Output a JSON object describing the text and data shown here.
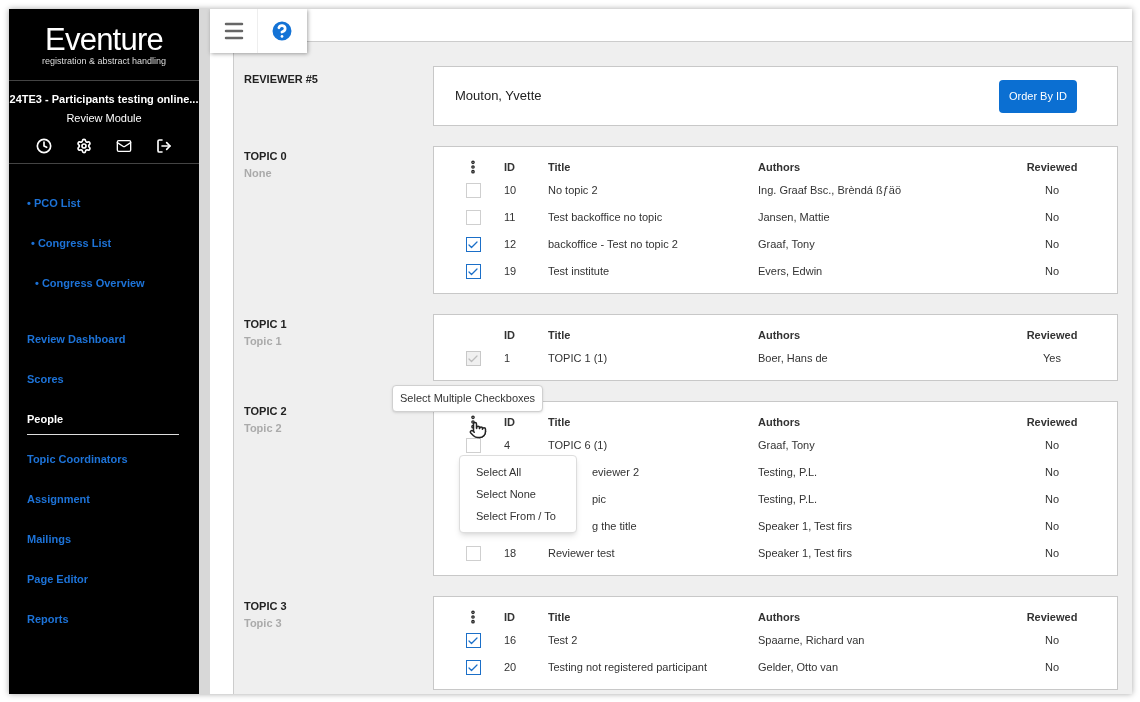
{
  "brand": {
    "logo": "Eventure",
    "tagline": "registration & abstract handling"
  },
  "event": {
    "name": "24TE3 - Participants testing online...",
    "module": "Review Module"
  },
  "nav_links": [
    {
      "label": "• PCO List"
    },
    {
      "label": "• Congress List"
    },
    {
      "label": "• Congress Overview"
    }
  ],
  "menu": [
    {
      "label": "Review Dashboard",
      "selected": false
    },
    {
      "label": "Scores",
      "selected": false
    },
    {
      "label": "People",
      "selected": true
    },
    {
      "label": "Topic Coordinators",
      "selected": false
    },
    {
      "label": "Assignment",
      "selected": false
    },
    {
      "label": "Mailings",
      "selected": false
    },
    {
      "label": "Page Editor",
      "selected": false
    },
    {
      "label": "Reports",
      "selected": false
    }
  ],
  "reviewer": {
    "label": "REVIEWER #5",
    "name": "Mouton, Yvette",
    "button": "Order By ID"
  },
  "topics": [
    {
      "label": "TOPIC 0",
      "name": "None",
      "show_menu": true,
      "columns": {
        "id": "ID",
        "title": "Title",
        "authors": "Authors",
        "reviewed": "Reviewed"
      },
      "rows": [
        {
          "kind": "full",
          "checked": false,
          "disabled": false,
          "id": "10",
          "title": "No topic 2",
          "authors": "Ing. Graaf Bsc., Brèndá ßƒäö",
          "reviewed": "No"
        },
        {
          "kind": "full",
          "checked": false,
          "disabled": false,
          "id": "11",
          "title": "Test backoffice no topic",
          "authors": "Jansen, Mattie",
          "reviewed": "No"
        },
        {
          "kind": "full",
          "checked": true,
          "disabled": false,
          "id": "12",
          "title": "backoffice - Test no topic 2",
          "authors": "Graaf, Tony",
          "reviewed": "No"
        },
        {
          "kind": "full",
          "checked": true,
          "disabled": false,
          "id": "19",
          "title": "Test institute",
          "authors": "Evers, Edwin",
          "reviewed": "No"
        }
      ]
    },
    {
      "label": "TOPIC 1",
      "name": "Topic 1",
      "show_menu": false,
      "columns": {
        "id": "ID",
        "title": "Title",
        "authors": "Authors",
        "reviewed": "Reviewed"
      },
      "rows": [
        {
          "kind": "full",
          "checked": true,
          "disabled": true,
          "id": "1",
          "title": "TOPIC 1 (1)",
          "authors": "Boer, Hans de",
          "reviewed": "Yes"
        }
      ]
    },
    {
      "label": "TOPIC 2",
      "name": "Topic 2",
      "show_menu": true,
      "columns": {
        "id": "ID",
        "title": "Title",
        "authors": "Authors",
        "reviewed": "Reviewed"
      },
      "dropdown": {
        "tooltip": "Select Multiple Checkboxes",
        "items": [
          "Select All",
          "Select None",
          "Select From / To"
        ]
      },
      "rows": [
        {
          "kind": "full",
          "checked": false,
          "disabled": false,
          "id": "4",
          "title": "TOPIC 6 (1)",
          "authors": "Graaf, Tony",
          "reviewed": "No"
        },
        {
          "kind": "covered",
          "title": "eviewer 2",
          "authors": "Testing, P.L.",
          "reviewed": "No"
        },
        {
          "kind": "covered",
          "title": "pic",
          "authors": "Testing, P.L.",
          "reviewed": "No"
        },
        {
          "kind": "covered",
          "title": "g the title",
          "authors": "Speaker 1, Test firs",
          "reviewed": "No"
        },
        {
          "kind": "full",
          "checked": false,
          "disabled": false,
          "id": "18",
          "title": "Reviewer test",
          "authors": "Speaker 1, Test firs",
          "reviewed": "No"
        }
      ]
    },
    {
      "label": "TOPIC 3",
      "name": "Topic 3",
      "show_menu": true,
      "columns": {
        "id": "ID",
        "title": "Title",
        "authors": "Authors",
        "reviewed": "Reviewed"
      },
      "rows": [
        {
          "kind": "full",
          "checked": true,
          "disabled": false,
          "id": "16",
          "title": "Test 2",
          "authors": "Spaarne, Richard van",
          "reviewed": "No"
        },
        {
          "kind": "full",
          "checked": true,
          "disabled": false,
          "id": "20",
          "title": "Testing not registered participant",
          "authors": "Gelder, Otto van",
          "reviewed": "No"
        }
      ]
    }
  ]
}
